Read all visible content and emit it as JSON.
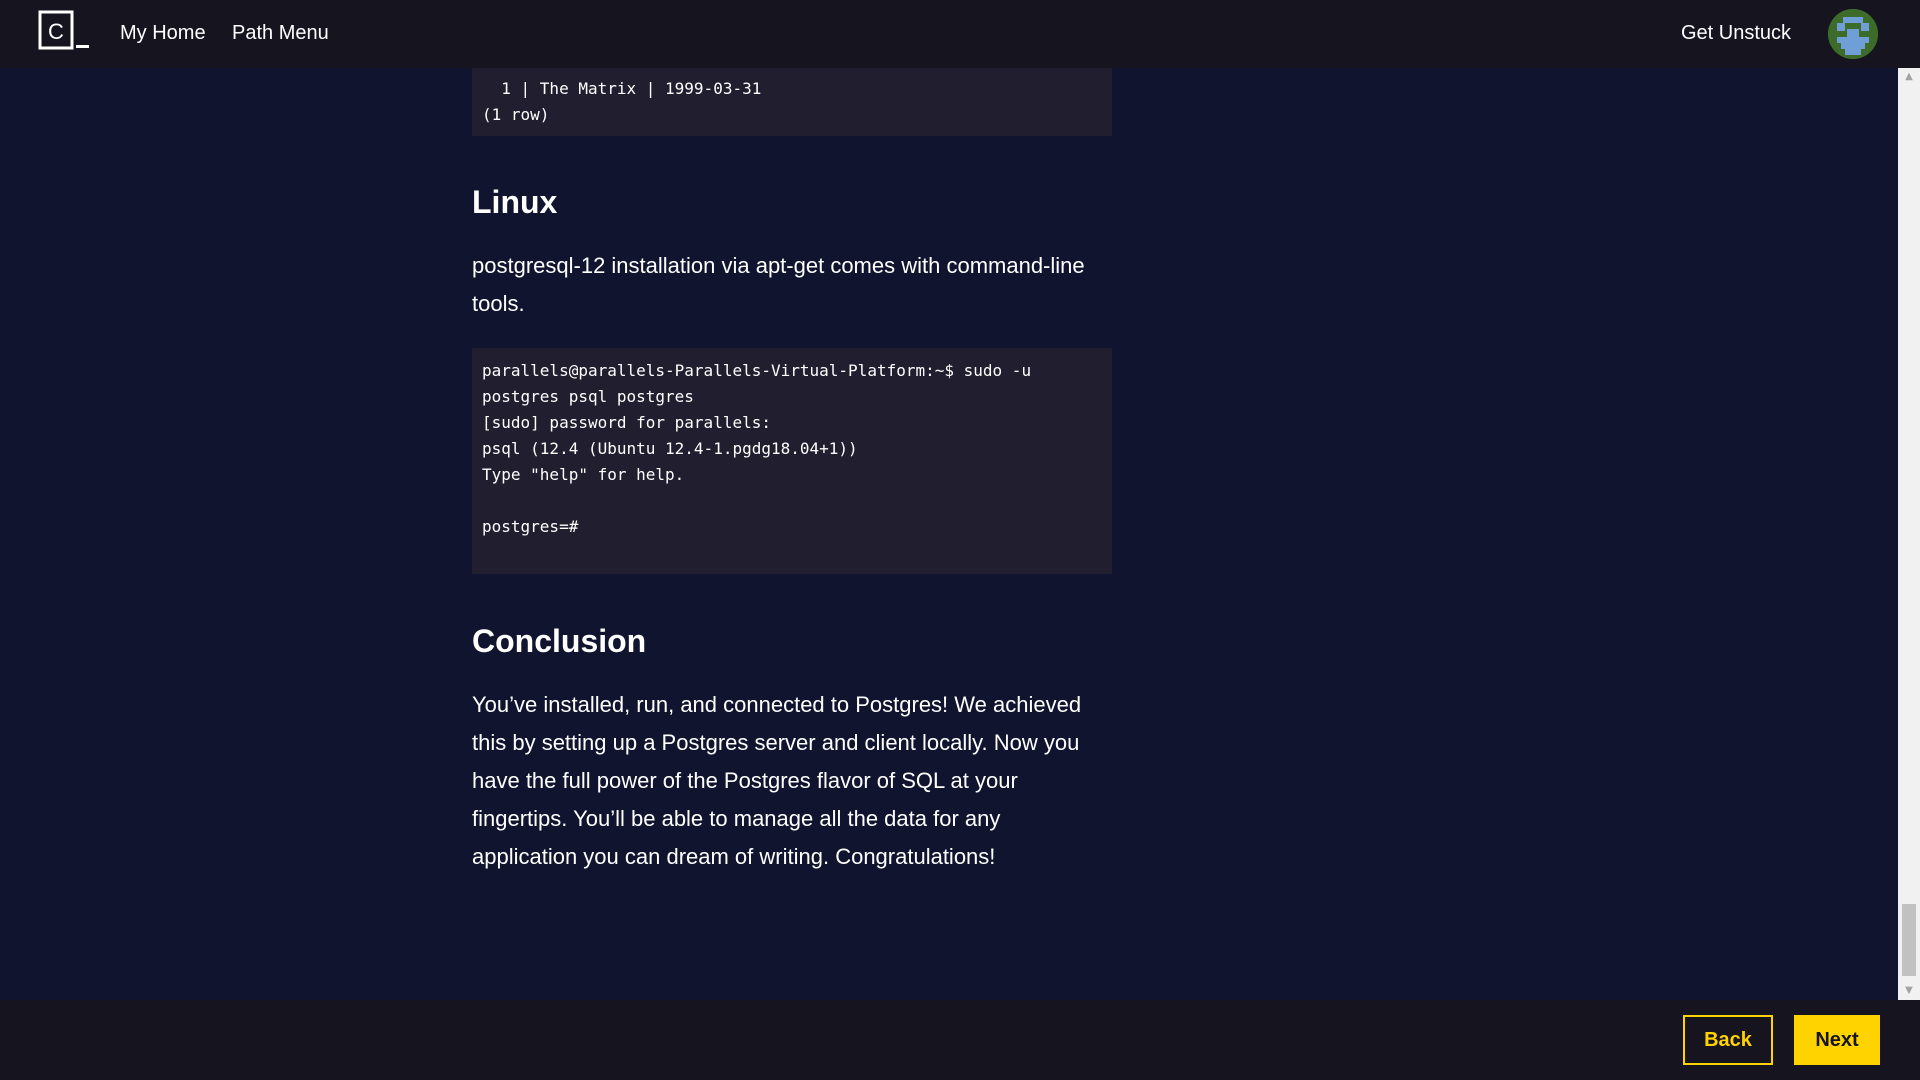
{
  "header": {
    "logo_letter": "C",
    "nav": {
      "home": "My Home",
      "path_menu": "Path Menu",
      "get_unstuck": "Get Unstuck"
    }
  },
  "content": {
    "top_code": "  1 | The Matrix | 1999-03-31\n(1 row)",
    "linux_heading": "Linux",
    "linux_text": "postgresql-12 installation via apt-get comes with command-line tools.",
    "linux_code": "parallels@parallels-Parallels-Virtual-Platform:~$ sudo -u\npostgres psql postgres\n[sudo] password for parallels:\npsql (12.4 (Ubuntu 12.4-1.pgdg18.04+1))\nType \"help\" for help.\n\npostgres=#",
    "conclusion_heading": "Conclusion",
    "conclusion_text": "You’ve installed, run, and connected to Postgres! We achieved this by setting up a Postgres server and client locally. Now you have the full power of the Postgres flavor of SQL at your fingertips. You’ll be able to manage all the data for any application you can dream of writing. Congratulations!"
  },
  "footer": {
    "back_label": "Back",
    "next_label": "Next"
  },
  "icons": {
    "logo": "codecademy-logo-icon",
    "avatar": "user-avatar-icon",
    "scroll_up": "scroll-up-arrow-icon",
    "scroll_down": "scroll-down-arrow-icon"
  },
  "colors": {
    "page_bg": "#10142e",
    "bar_bg": "#15141f",
    "code_bg": "#211f2f",
    "accent": "#ffd300"
  }
}
